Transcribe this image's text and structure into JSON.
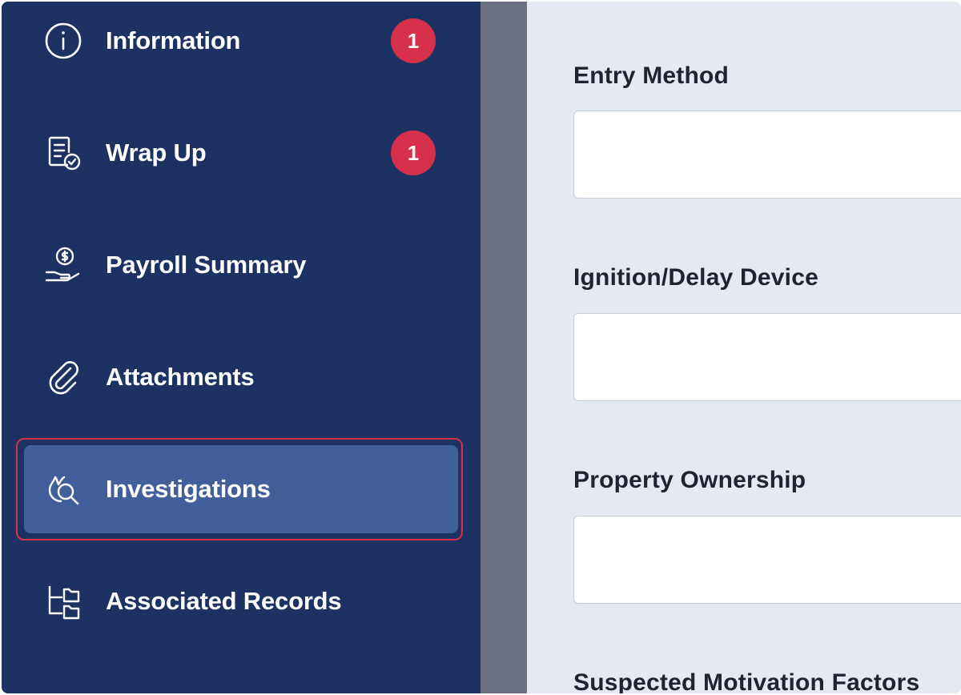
{
  "sidebar": {
    "items": [
      {
        "label": "Information",
        "icon": "info-icon",
        "badge": "1"
      },
      {
        "label": "Wrap Up",
        "icon": "document-check-icon",
        "badge": "1"
      },
      {
        "label": "Payroll Summary",
        "icon": "hand-dollar-icon"
      },
      {
        "label": "Attachments",
        "icon": "paperclip-icon"
      },
      {
        "label": "Investigations",
        "icon": "investigation-icon",
        "active": true
      },
      {
        "label": "Associated Records",
        "icon": "folder-tree-icon"
      }
    ]
  },
  "form": {
    "fields": [
      {
        "label": "Entry Method",
        "value": ""
      },
      {
        "label": "Ignition/Delay Device",
        "value": ""
      },
      {
        "label": "Property Ownership",
        "value": ""
      },
      {
        "label": "Suspected Motivation Factors"
      }
    ]
  },
  "colors": {
    "sidebar_bg": "#1c3263",
    "active_item_bg": "#41609a",
    "badge": "#d7304a",
    "highlight_border": "#d7304a",
    "content_bg": "#e4e9f2"
  }
}
